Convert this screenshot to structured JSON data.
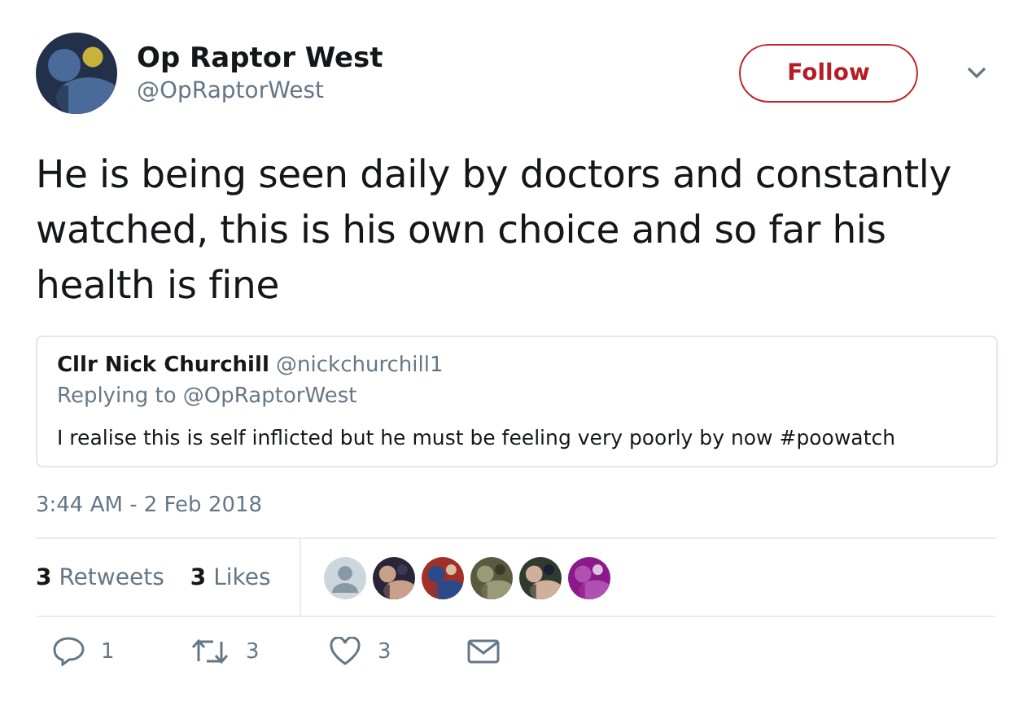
{
  "author": {
    "name": "Op Raptor West",
    "handle": "@OpRaptorWest",
    "avatar": {
      "kind": "picture"
    }
  },
  "follow_button": {
    "label": "Follow"
  },
  "text": "He is being seen daily by doctors and constantly watched, this is his own choice and so far his health is fine",
  "quoted_tweet": {
    "name": "Cllr Nick Churchill",
    "handle": "@nickchurchill1",
    "replying_to": "Replying to @OpRaptorWest",
    "text": "I realise this is self inflicted but he must be feeling very poorly by now #poowatch"
  },
  "timestamp": "3:44 AM - 2 Feb 2018",
  "stats": [
    {
      "count": "3",
      "label": "Retweets"
    },
    {
      "count": "3",
      "label": "Likes"
    }
  ],
  "likers": [
    {
      "kind": "default"
    },
    {
      "kind": "picture"
    },
    {
      "kind": "picture"
    },
    {
      "kind": "picture"
    },
    {
      "kind": "picture"
    },
    {
      "kind": "picture"
    }
  ],
  "actions": [
    {
      "kind": "reply",
      "count": "1"
    },
    {
      "kind": "retweet",
      "count": "3"
    },
    {
      "kind": "like",
      "count": "3"
    },
    {
      "kind": "message"
    }
  ]
}
